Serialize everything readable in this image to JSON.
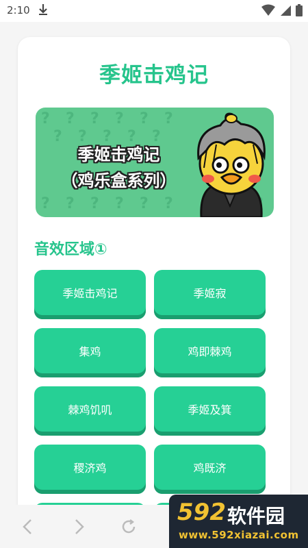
{
  "status_bar": {
    "time": "2:10"
  },
  "page": {
    "title": "季姬击鸡记"
  },
  "banner": {
    "line1": "季姬击鸡记",
    "line2": "（鸡乐盒系列）"
  },
  "section": {
    "title": "音效区域①"
  },
  "sound_buttons": [
    "季姬击鸡记",
    "季姬寂",
    "集鸡",
    "鸡即棘鸡",
    "棘鸡饥叽",
    "季姬及箕",
    "稷济鸡",
    "鸡既济"
  ],
  "watermark": {
    "number": "592",
    "name": "软件园",
    "url": "www.592xiazai.com"
  },
  "colors": {
    "accent": "#26c48c",
    "button": "#26d095",
    "banner": "#5fc98f"
  }
}
